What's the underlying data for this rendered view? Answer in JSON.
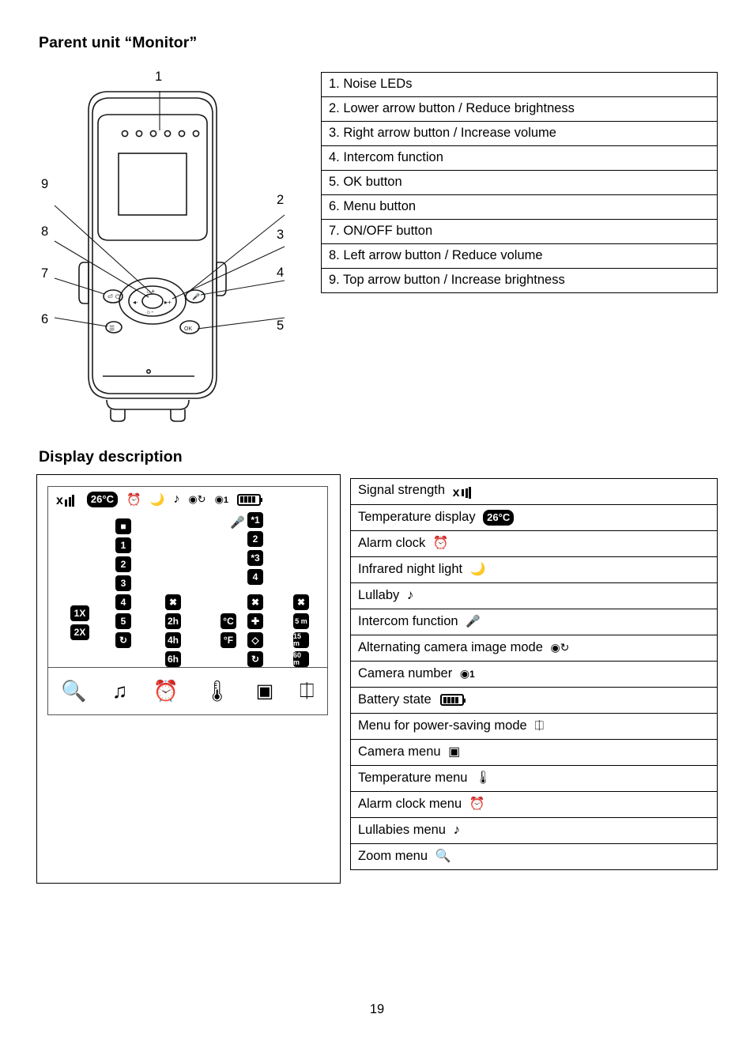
{
  "page": {
    "number": "19"
  },
  "sections": {
    "parent_unit": {
      "title": "Parent unit “Monitor”",
      "callout_numbers": [
        "1",
        "2",
        "3",
        "4",
        "5",
        "6",
        "7",
        "8",
        "9"
      ],
      "legend": [
        "1. Noise LEDs",
        "2. Lower arrow button / Reduce brightness",
        "3. Right arrow button / Increase volume",
        "4. Intercom function",
        "5. OK button",
        "6. Menu button",
        "7. ON/OFF button",
        "8. Left arrow button / Reduce volume",
        "9. Top arrow button / Increase brightness"
      ],
      "device_labels": {
        "ok": "OK"
      }
    },
    "display_description": {
      "title": "Display description",
      "legend": [
        {
          "label": "Signal strength",
          "icon": "signal-strength-icon"
        },
        {
          "label": "Temperature display",
          "icon": "temperature-badge-icon",
          "value": "26°C"
        },
        {
          "label": "Alarm clock",
          "icon": "alarm-clock-icon"
        },
        {
          "label": "Infrared night light",
          "icon": "moon-icon"
        },
        {
          "label": "Lullaby",
          "icon": "music-note-icon"
        },
        {
          "label": "Intercom function",
          "icon": "microphone-icon"
        },
        {
          "label": "Alternating camera image mode",
          "icon": "camera-cycle-icon"
        },
        {
          "label": "Camera number",
          "icon": "camera-number-icon",
          "value": "1"
        },
        {
          "label": "Battery state",
          "icon": "battery-icon"
        },
        {
          "label": "Menu for power-saving mode",
          "icon": "power-saving-icon"
        },
        {
          "label": "Camera menu",
          "icon": "camera-menu-icon"
        },
        {
          "label": "Temperature menu",
          "icon": "thermometer-icon"
        },
        {
          "label": "Alarm clock menu",
          "icon": "alarm-clock-menu-icon"
        },
        {
          "label": "Lullabies menu",
          "icon": "lullabies-menu-icon"
        },
        {
          "label": "Zoom menu",
          "icon": "zoom-menu-icon"
        }
      ],
      "lcd": {
        "status_bar": {
          "temperature": "26°C",
          "camera_number": "1"
        },
        "column_left_prefix": [
          "1X",
          "2X"
        ],
        "column_1": [
          "■",
          "1",
          "2",
          "3",
          "4",
          "5",
          "↻"
        ],
        "column_2": [
          "✖",
          "2h",
          "4h",
          "6h"
        ],
        "column_3_top": [
          "*1",
          "2",
          "*3"
        ],
        "column_3": [
          "4",
          "✖",
          "✚",
          "◇",
          "↻"
        ],
        "column_4_units": [
          "°C",
          "°F"
        ],
        "column_5": [
          "✖",
          "5 m",
          "15 m",
          "60 m"
        ],
        "bottom_menu": [
          "zoom-menu-icon",
          "lullabies-menu-icon",
          "alarm-clock-menu-icon",
          "thermometer-icon",
          "camera-menu-icon",
          "power-saving-icon"
        ]
      }
    }
  }
}
